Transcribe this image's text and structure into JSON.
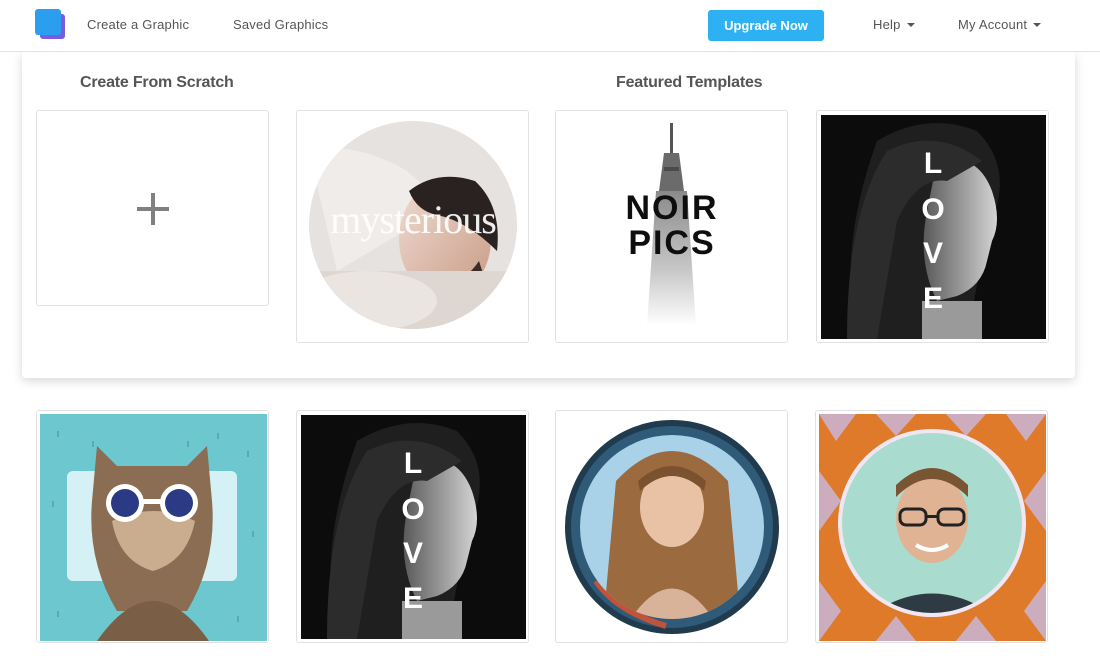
{
  "nav": {
    "create_label": "Create a Graphic",
    "saved_label": "Saved Graphics",
    "upgrade_label": "Upgrade Now",
    "help_label": "Help",
    "account_label": "My Account"
  },
  "panel": {
    "scratch_title": "Create From Scratch",
    "featured_title": "Featured Templates"
  },
  "templates": [
    {
      "text": "mysterious"
    },
    {
      "line1": "NOIR",
      "line2": "PICS"
    },
    {
      "letters": [
        "L",
        "O",
        "V",
        "E"
      ]
    }
  ],
  "grid": [
    {
      "icon": "cat-sunglasses-image"
    },
    {
      "letters": [
        "L",
        "O",
        "V",
        "E"
      ]
    },
    {
      "icon": "woman-portrait-circle-image"
    },
    {
      "icon": "man-portrait-mosaic-image"
    }
  ],
  "colors": {
    "brand": "#2b9ef0",
    "upgrade": "#2eb1f2",
    "cat_bg": "#6cc7cf"
  }
}
